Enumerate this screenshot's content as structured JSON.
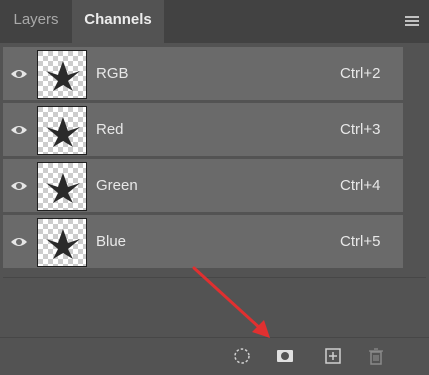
{
  "tabs": [
    {
      "label": "Layers",
      "active": false
    },
    {
      "label": "Channels",
      "active": true
    }
  ],
  "channels": [
    {
      "name": "RGB",
      "shortcut": "Ctrl+2"
    },
    {
      "name": "Red",
      "shortcut": "Ctrl+3"
    },
    {
      "name": "Green",
      "shortcut": "Ctrl+4"
    },
    {
      "name": "Blue",
      "shortcut": "Ctrl+5"
    }
  ],
  "footer_icons": [
    "load-channel-as-selection-icon",
    "save-selection-as-channel-icon",
    "new-channel-icon",
    "delete-channel-icon"
  ],
  "colors": {
    "panel_bg": "#535353",
    "row_bg": "#6a6a6a",
    "tabbar_bg": "#424242",
    "arrow": "#e03030"
  }
}
